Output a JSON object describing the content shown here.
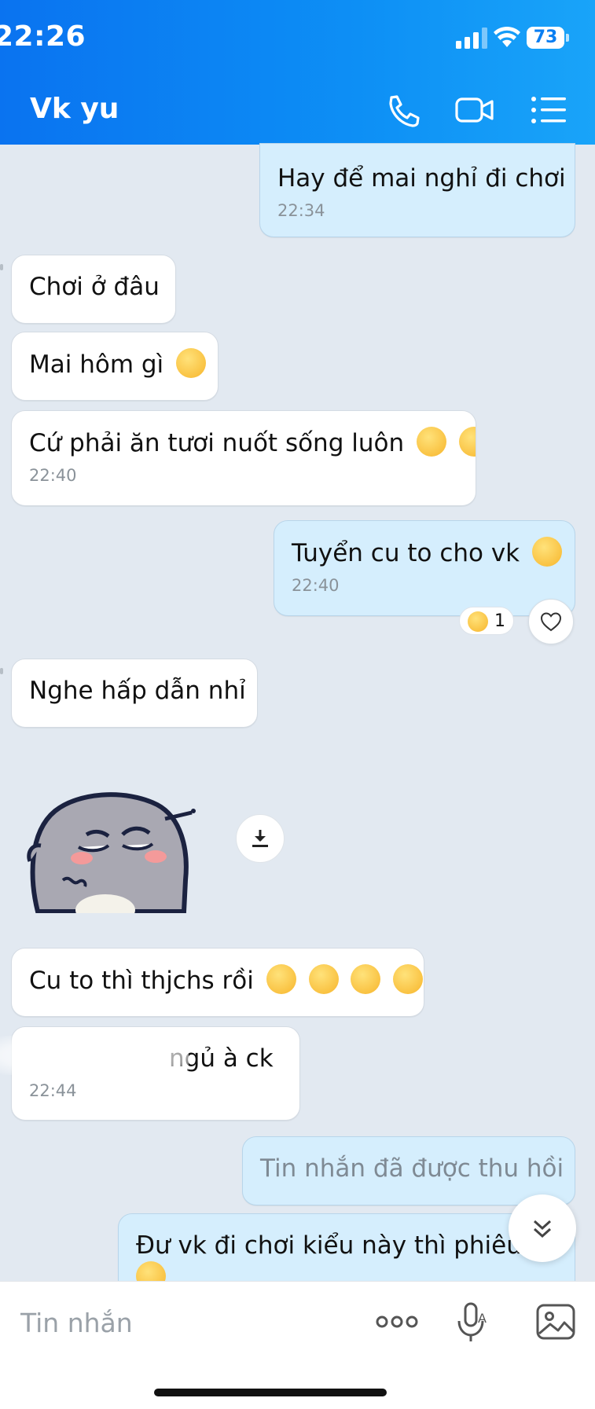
{
  "status_bar": {
    "time": "22:26",
    "battery": "73"
  },
  "header": {
    "title": "Vk yu",
    "icons": [
      "phone-icon",
      "video-call-icon",
      "menu-list-icon"
    ]
  },
  "messages": [
    {
      "id": "m1",
      "dir": "out",
      "text": "Hay để mai nghỉ đi chơi",
      "time": "22:34"
    },
    {
      "id": "m2",
      "dir": "in",
      "text": "Chơi ở đâu"
    },
    {
      "id": "m3",
      "dir": "in",
      "text": "Mai hôm gì",
      "emoji": [
        "pacman-face-emoji"
      ]
    },
    {
      "id": "m4",
      "dir": "in",
      "text": "Cứ phải ăn tươi nuốt sống luôn",
      "emoji": [
        "thinking-face-emoji",
        "laughing-tears-emoji"
      ],
      "time": "22:40"
    },
    {
      "id": "m5",
      "dir": "out",
      "text": "Tuyển cu to cho vk",
      "emoji": [
        "laughing-face-emoji"
      ],
      "time": "22:40",
      "reaction": {
        "icon": "surprised-face-emoji",
        "count": "1"
      }
    },
    {
      "id": "m6",
      "dir": "in",
      "text": "Nghe hấp dẫn nhỉ"
    },
    {
      "id": "m7",
      "dir": "in",
      "type": "sticker",
      "sticker": "gray-blob-sticker"
    },
    {
      "id": "m8",
      "dir": "in",
      "text": "Cu to thì thjchs rồi",
      "emoji": [
        "thinking-face-emoji",
        "laughing-tears-emoji",
        "laughing-tears-emoji",
        "laughing-tears-emoji"
      ]
    },
    {
      "id": "m9",
      "dir": "in",
      "text": "ngủ à ck",
      "time": "22:44"
    },
    {
      "id": "m10",
      "dir": "out",
      "text": "Tin nhắn đã được thu hồi",
      "recalled": true
    },
    {
      "id": "m11",
      "dir": "out",
      "text": "Đư vk đi chơi kiểu này thì phiêu n",
      "emoji": [
        "laughing-face-emoji"
      ]
    }
  ],
  "input": {
    "placeholder": "Tin nhắn"
  },
  "colors": {
    "header_start": "#0a73f0",
    "header_end": "#19a4f9",
    "outgoing_bubble": "#d5eefd",
    "incoming_bubble": "#ffffff",
    "chat_bg": "#e2e9f1"
  }
}
